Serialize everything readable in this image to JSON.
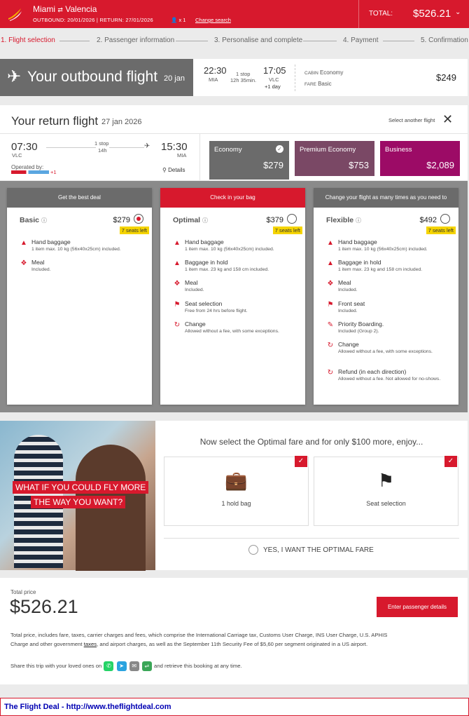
{
  "header": {
    "route_from": "Miami",
    "route_swap": "⇄",
    "route_to": "Valencia",
    "outbound_label": "OUTBOUND: 20/01/2026",
    "return_label": "RETURN: 27/01/2026",
    "passengers": "x 1",
    "change_search": "Change search",
    "total_label": "TOTAL:",
    "total_value": "$526.21",
    "chevron": "⌄"
  },
  "steps": [
    "1. Flight selection",
    "2. Passenger information",
    "3. Personalise and complete",
    "4. Payment",
    "5. Confirmation"
  ],
  "outbound": {
    "title": "Your outbound flight",
    "date": "20 jan",
    "dep_time": "22:30",
    "dep_code": "MIA",
    "stops": "1 stop",
    "duration": "12h 35min.",
    "arr_time": "17:05",
    "arr_code": "VLC",
    "plus_day": "+1 day",
    "cabin_label": "CABIN",
    "cabin_value": "Economy",
    "fare_label": "FARE",
    "fare_value": "Basic",
    "price": "$249"
  },
  "return": {
    "title": "Your return flight",
    "date": "27 jan 2026",
    "select_another": "Select another flight",
    "dep_time": "07:30",
    "dep_code": "VLC",
    "stops": "1 stop",
    "duration": "14h",
    "arr_time": "15:30",
    "arr_code": "MIA",
    "operated_by": "Operated by:",
    "operator_extra": "+1",
    "details": "Details"
  },
  "cabins": [
    {
      "name": "Economy",
      "price": "$279",
      "color": "#6b6b6b"
    },
    {
      "name": "Premium Economy",
      "price": "$753",
      "color": "#7a4865"
    },
    {
      "name": "Business",
      "price": "$2,089",
      "color": "#9c0b66"
    }
  ],
  "fares": [
    {
      "header": "Get the best deal",
      "header_color": "#6b6b6b",
      "name": "Basic",
      "price": "$279",
      "seats": "7 seats left",
      "selected": true,
      "features": [
        {
          "icon": "bag",
          "title": "Hand baggage",
          "desc": "1 item max. 10 kg (56x40x25cm) included."
        },
        {
          "icon": "meal",
          "title": "Meal",
          "desc": "Included."
        }
      ]
    },
    {
      "header": "Check in your bag",
      "header_color": "#d7192d",
      "name": "Optimal",
      "price": "$379",
      "seats": "7 seats left",
      "selected": false,
      "features": [
        {
          "icon": "bag",
          "title": "Hand baggage",
          "desc": "1 item max. 10 kg (56x40x25cm) included."
        },
        {
          "icon": "bag",
          "title": "Baggage in hold",
          "desc": "1 item max. 23 kg and 158 cm included."
        },
        {
          "icon": "meal",
          "title": "Meal",
          "desc": "Included."
        },
        {
          "icon": "seat",
          "title": "Seat selection",
          "desc": "Free from 24 hrs before flight."
        },
        {
          "icon": "change",
          "title": "Change",
          "desc": "Allowed without a fee, with some exceptions."
        }
      ]
    },
    {
      "header": "Change your flight as many times as you need to",
      "header_color": "#6b6b6b",
      "name": "Flexible",
      "price": "$492",
      "seats": "7 seats left",
      "selected": false,
      "features": [
        {
          "icon": "bag",
          "title": "Hand baggage",
          "desc": "1 item max. 10 kg (56x40x25cm) included."
        },
        {
          "icon": "bag",
          "title": "Baggage in hold",
          "desc": "1 item max. 23 kg and 158 cm included."
        },
        {
          "icon": "meal",
          "title": "Meal",
          "desc": "Included."
        },
        {
          "icon": "seat",
          "title": "Front seat",
          "desc": "Included."
        },
        {
          "icon": "walk",
          "title": "Priority Boarding.",
          "desc": "Included (Group 2)."
        },
        {
          "icon": "change",
          "title": "Change",
          "desc": "Allowed without a fee, with some exceptions."
        },
        {
          "icon": "change",
          "title": "Refund (in each direction)",
          "desc": "Allowed without a fee. Not allowed for no-shows."
        }
      ]
    }
  ],
  "promo": {
    "banner_line1": "WHAT IF YOU COULD FLY MORE",
    "banner_line2": "THE WAY YOU WANT?",
    "headline": "Now select the Optimal fare and for only $100 more, enjoy...",
    "box1": "1 hold bag",
    "box2": "Seat selection",
    "yes": "YES, I WANT THE OPTIMAL FARE"
  },
  "total": {
    "label": "Total price",
    "value": "$526.21",
    "button": "Enter passenger details",
    "fine1": "Total price, includes fare, taxes, carrier charges and fees, which comprise the International Carriage tax, Customs User Charge, INS User Charge, U.S. APHIS",
    "fine2a": "Charge and other government ",
    "fine2_link": "taxes",
    "fine2b": ", and airport charges, as well as the September 11th Security Fee of $5,60 per segment originated in a US airport.",
    "share_a": "Share this trip with your loved ones on",
    "share_b": "and retrieve this booking at any time."
  },
  "footer": {
    "text": "The Flight Deal - http://www.theflightdeal.com"
  },
  "colors": {
    "brand": "#d7192d",
    "seats_badge": "#f5d400"
  }
}
